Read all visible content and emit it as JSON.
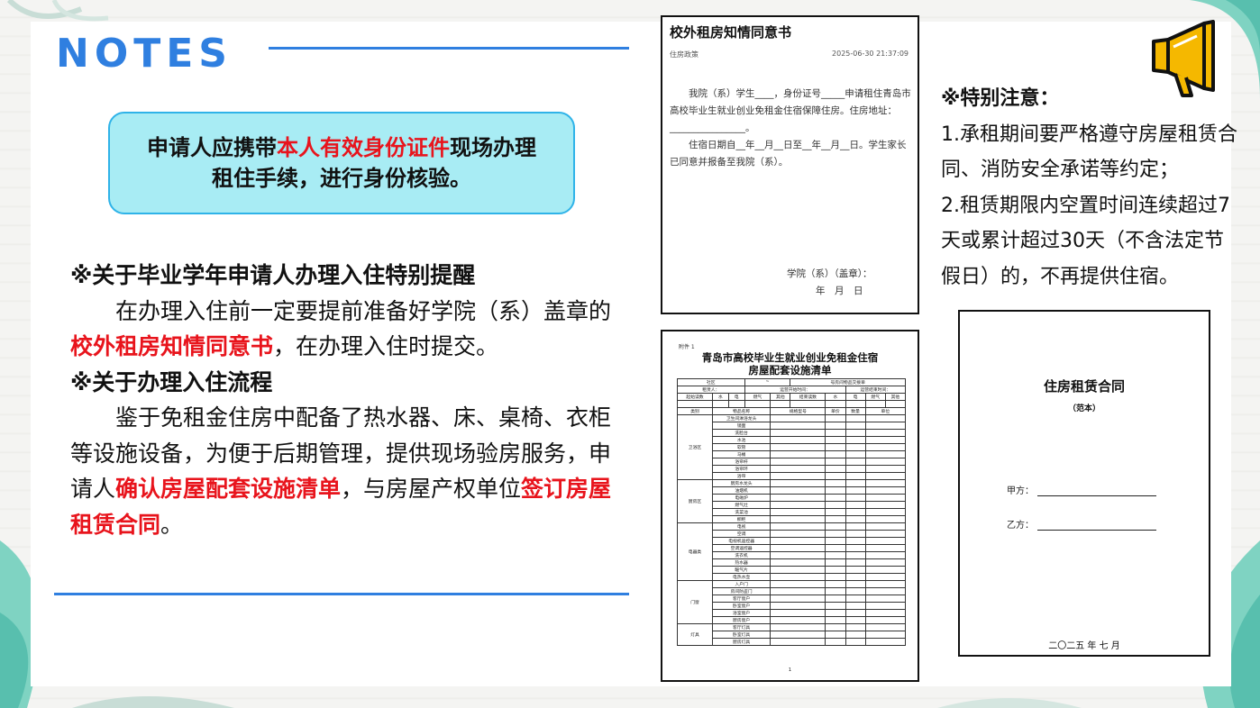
{
  "header": {
    "title": "NOTES"
  },
  "callout": {
    "before": "申请人应携带",
    "highlight": "本人有效身份证件",
    "after": "现场办理租住手续，进行身份核验。"
  },
  "section1": {
    "heading": "※关于毕业学年申请人办理入住特别提醒",
    "line_before": "在办理入住前一定要提前准备好学院（系）盖章的",
    "line_highlight": "校外租房知情同意书",
    "line_after": "，在办理入住时提交。"
  },
  "section2": {
    "heading": "※关于办理入住流程",
    "p_before": "鉴于免租金住房中配备了热水器、床、桌椅、衣柜等设施设备，为便于后期管理，提供现场验房服务，申请人",
    "highlight1": "确认房屋配套设施清单",
    "p_middle": "，与房屋产权单位",
    "highlight2": "签订房屋租赁合同",
    "p_end": "。"
  },
  "notice": {
    "heading": "※特别注意：",
    "item1": "1.承租期间要严格遵守房屋租赁合同、消防安全承诺等约定；",
    "item2": "2.租赁期限内空置时间连续超过7天或累计超过30天（不含法定节假日）的，不再提供住宿。"
  },
  "doc_consent": {
    "title": "校外租房知情同意书",
    "category": "住房政策",
    "timestamp": "2025-06-30 21:37:09",
    "para1": "我院（系）学生____，身份证号_____申请租住青岛市高校毕业生就业创业免租金住宿保障住房。住房地址：________________。",
    "para2": "住宿日期自__年__月__日至__年__月__日。学生家长已同意并报备至我院（系）。",
    "sign_line1": "学院（系）（盖章）：",
    "sign_line2": "年　月　日"
  },
  "doc_checklist": {
    "tag": "附件 1",
    "title_line1": "青岛市高校毕业生就业创业免租金住宿",
    "title_line2": "房屋配套设施清单",
    "header_row1": [
      "社区",
      "~",
      "号房间物品交接单"
    ],
    "header_row2": [
      "租赁人：",
      "运营开始时间：",
      "运营结束时间："
    ],
    "meter_row": [
      "起始读数",
      "水",
      "电",
      "燃气",
      "其他",
      "结束读数",
      "水",
      "电",
      "燃气",
      "其他"
    ],
    "col_headers": [
      "类别",
      "物品名称",
      "规格型号",
      "单价",
      "数量",
      "单位"
    ],
    "groups": [
      {
        "name": "卫浴区",
        "items": [
          "卫生间淋浴龙头",
          "镜面",
          "洗脸台",
          "水池",
          "软管",
          "马桶",
          "浴帘杆",
          "浴帘环",
          "浴帘"
        ]
      },
      {
        "name": "厨房区",
        "items": [
          "厨房水龙头",
          "油烟机",
          "电磁炉",
          "燃气灶",
          "洗菜池",
          "橱柜"
        ]
      },
      {
        "name": "电器类",
        "items": [
          "电视",
          "空调",
          "电视机遥控器",
          "空调遥控器",
          "洗衣机",
          "热水器",
          "暖气片",
          "电热水壶"
        ]
      },
      {
        "name": "门窗",
        "items": [
          "入户门",
          "房间防盗门",
          "客厅窗户",
          "卧室窗户",
          "浴室窗户",
          "厨房窗户"
        ]
      },
      {
        "name": "灯具",
        "items": [
          "客厅灯具",
          "卧室灯具",
          "厨房灯具"
        ]
      }
    ],
    "page": "1"
  },
  "doc_contract": {
    "title": "住房租赁合同",
    "subtitle": "（范本）",
    "party_a": "甲方：",
    "party_b": "乙方：",
    "date": "二〇二五 年 七 月"
  },
  "colors": {
    "accent": "#2f7fe0",
    "highlight": "#e8141c",
    "callout_bg": "#a8ecf4",
    "callout_border": "#2fb3e8",
    "megaphone": "#f5b800"
  },
  "icons": {
    "megaphone": "megaphone-icon"
  }
}
